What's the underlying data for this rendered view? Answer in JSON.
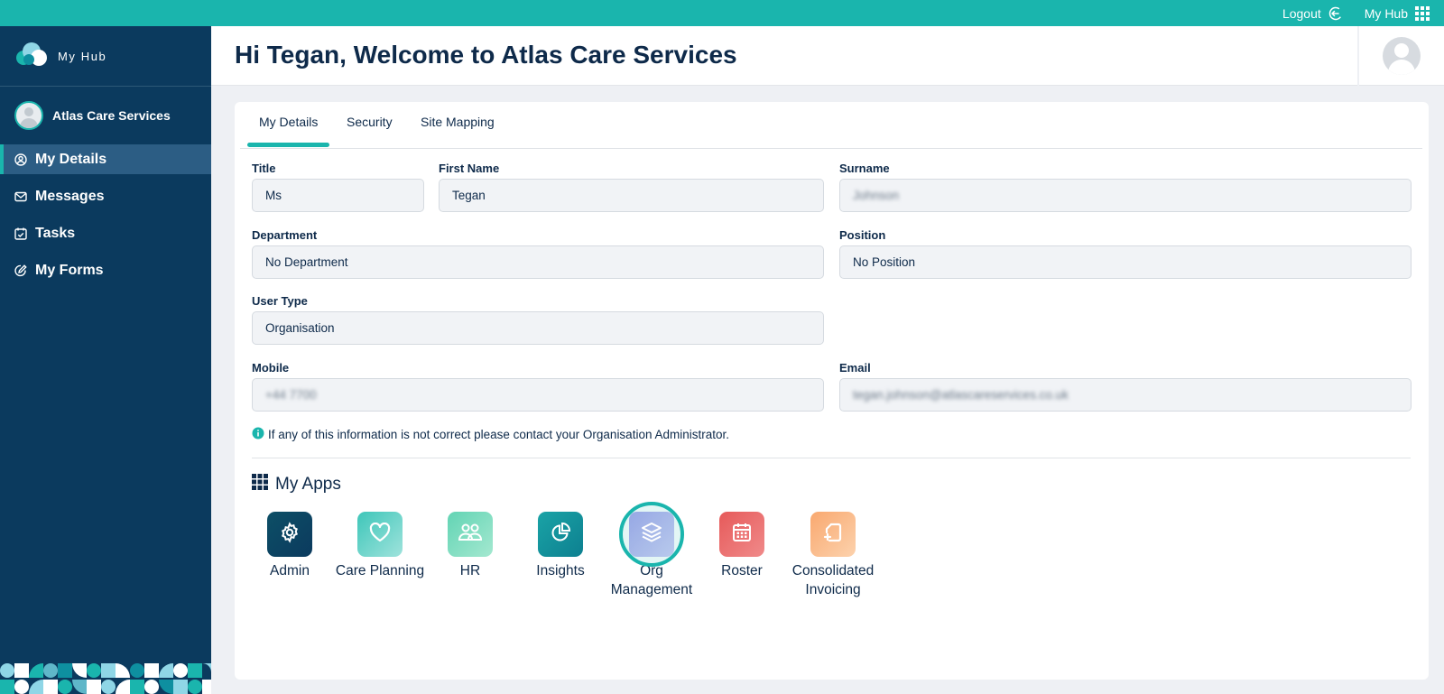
{
  "topbar": {
    "logout_label": "Logout",
    "hub_label": "My Hub",
    "accent_color": "#1ab5ad"
  },
  "sidebar": {
    "brand_name": "My Hub",
    "org_name": "Atlas Care Services",
    "items": [
      {
        "label": "My Details",
        "icon": "user-circle-icon",
        "active": true
      },
      {
        "label": "Messages",
        "icon": "envelope-icon",
        "active": false
      },
      {
        "label": "Tasks",
        "icon": "calendar-check-icon",
        "active": false
      },
      {
        "label": "My Forms",
        "icon": "form-edit-icon",
        "active": false
      }
    ],
    "background_color": "#0b3a5e"
  },
  "header": {
    "title": "Hi Tegan, Welcome to Atlas Care Services"
  },
  "tabs": [
    {
      "label": "My Details",
      "active": true
    },
    {
      "label": "Security",
      "active": false
    },
    {
      "label": "Site Mapping",
      "active": false
    }
  ],
  "form": {
    "title": {
      "label": "Title",
      "value": "Ms"
    },
    "first_name": {
      "label": "First Name",
      "value": "Tegan"
    },
    "surname": {
      "label": "Surname",
      "value": "Johnson"
    },
    "department": {
      "label": "Department",
      "value": "No Department"
    },
    "position": {
      "label": "Position",
      "value": "No Position"
    },
    "user_type": {
      "label": "User Type",
      "value": "Organisation"
    },
    "mobile": {
      "label": "Mobile",
      "value": "+44 7700"
    },
    "email": {
      "label": "Email",
      "value": "tegan.johnson@atlascareservices.co.uk"
    }
  },
  "info_text": "If any of this information is not correct please contact your Organisation Administrator.",
  "apps": {
    "title": "My Apps",
    "items": [
      {
        "label": "Admin",
        "icon": "gear-icon",
        "color": "#0d4f66"
      },
      {
        "label": "Care Planning",
        "icon": "heart-icon",
        "color": "#5fd0c6"
      },
      {
        "label": "HR",
        "icon": "people-icon",
        "color": "#7fdcc0"
      },
      {
        "label": "Insights",
        "icon": "pie-chart-icon",
        "color": "#1aa3a6"
      },
      {
        "label": "Org Management",
        "icon": "layers-icon",
        "color": "#b5b3ee"
      },
      {
        "label": "Roster",
        "icon": "calendar-icon",
        "color": "#ea6666"
      },
      {
        "label": "Consolidated Invoicing",
        "icon": "invoice-icon",
        "color": "#f8b98a"
      }
    ]
  }
}
